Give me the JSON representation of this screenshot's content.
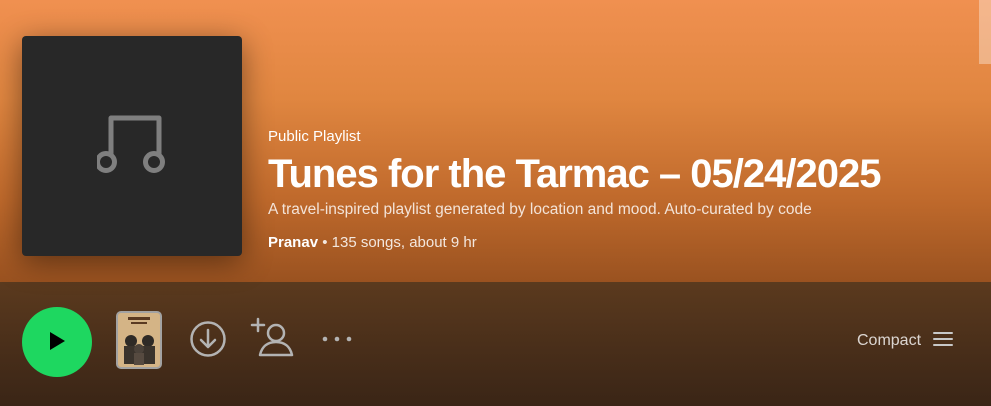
{
  "playlist": {
    "type_label": "Public Playlist",
    "title": "Tunes for the Tarmac – 05/24/2025",
    "description": "A travel-inspired playlist generated by location and mood. Auto-curated by code",
    "owner": "Pranav",
    "stats": " • 135 songs, about 9 hr",
    "cover_icon": "music-note-icon"
  },
  "actions": {
    "play_icon": "play-icon",
    "preview_cover_icon": "album-cover-thumbnail",
    "download_icon": "download-circle-icon",
    "add_user_icon": "add-collaborator-icon",
    "more_icon": "more-options-icon",
    "view_mode_label": "Compact",
    "view_mode_icon": "list-lines-icon"
  },
  "colors": {
    "header_top": "#f09050",
    "header_bottom": "#9a5220",
    "play_button": "#1ed760",
    "cover_bg": "#282828"
  }
}
